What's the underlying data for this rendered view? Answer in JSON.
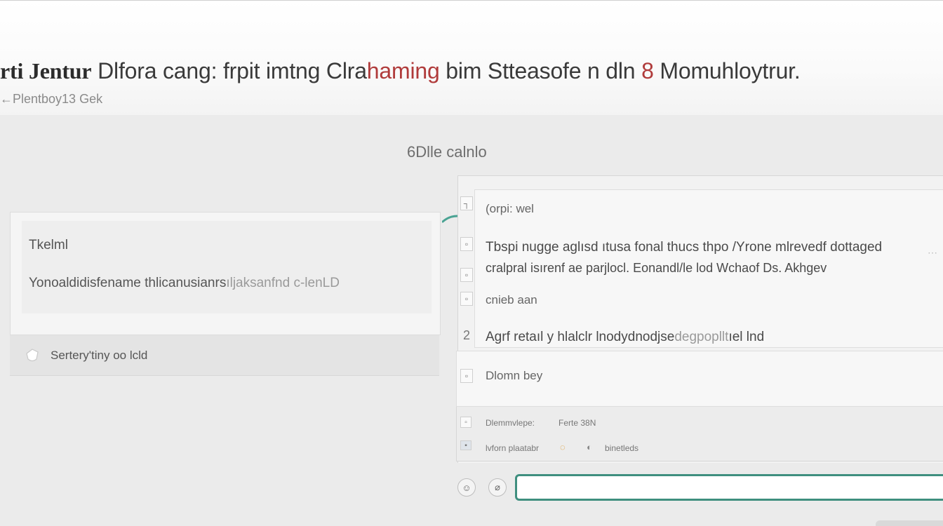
{
  "header": {
    "title_brand": "rti Jentur",
    "title_main": "Dlfora cang: frpit imtng Clra",
    "title_accent": "haming",
    "title_rest": "bim Stteasofe n dln",
    "title_number": "8",
    "title_tail": "Momuhloytrur.",
    "subtitle": "←Plentboy13 Gek"
  },
  "main": {
    "section_title": "6Dlle calnlo",
    "left_card": {
      "label": "Tkelml",
      "text": "Yonoaldidisfename thlicanusianrs",
      "text_muted": "ıljaksanfnd",
      "text_tail": "c-lenLD"
    },
    "left_action": {
      "label": "Sertery'tiny oo lcld",
      "icon": "shield-icon"
    },
    "right_panel": {
      "header": "(orpi: wel",
      "line1": "Tbspi nugge aglısd ıtusa fonal thucs thpo /Yrone mlrevedf dottaged",
      "line2": "cralpral isırenf ae parjlocl. Eonandl/le lod Wchaof Ds. Akhgev",
      "line3": "cnieb aan",
      "line4_main": "Agrf retaıl y hlalclr lnodydnodjse",
      "line4_muted": "degpopllt",
      "line4_tail": "ıel lnd",
      "row_num": "2",
      "domain_label": "Dlomn bey",
      "meta1_label": "Dlemmvlepe:",
      "meta1_value": "Ferte 38N",
      "meta2_label": "lvforn plaatabr",
      "meta2_value": "binetleds"
    },
    "composer": {
      "placeholder": "",
      "value": ""
    }
  },
  "colors": {
    "accent": "#3f8f7f",
    "title_accent": "#b03b3b",
    "background": "#ebebeb"
  }
}
